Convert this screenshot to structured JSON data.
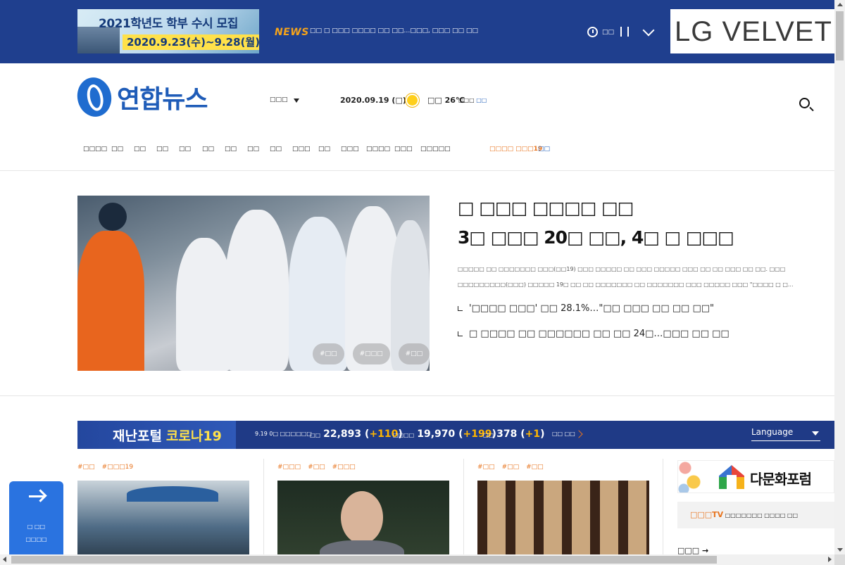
{
  "top_banner": {
    "ad_left": {
      "line1": "2021학년도 학부 수시 모집",
      "line2": "2020.9.23(수)~9.28(월)"
    },
    "news_label": "NEWS",
    "news_headline": "□□ □ □□□ □□□□ □□ □□…□□□, □□□ □□ □□",
    "clock_label": "□□",
    "ad_right": "LG VELVET"
  },
  "header": {
    "logo_text": "연합뉴스",
    "lang_label": "□□□",
    "date": "2020.09.19 (□)",
    "temperature": "□□ 26℃",
    "air_label": "□□□",
    "air_value": "□□"
  },
  "nav": {
    "items": [
      "□□□□",
      "□□",
      "□□",
      "□□",
      "□□",
      "□□",
      "□□",
      "□□",
      "□□",
      "□□□",
      "□□",
      "□□□",
      "□□□□",
      "□□□",
      "□□□□□"
    ],
    "special": "□□□□ □□□19",
    "extra": "□□"
  },
  "hero": {
    "title_line1": "□ □□□ □□□□ □□",
    "title_line2": "3□ □□□ 20□ □□, 4□ □ □□□",
    "summary": "□□□□□ □□ □□□□□□□ □□□(□□19) □□□ □□□□□ □□ □□□ □□□□□ □□□ □□ □□ □□□ □□ □□. □□□ □□□□□□□□□(□□□) □□□□□ 19□ □□ □□ □□□□□□□ □□ □□□□□□□ □□□ □□□□□ □□□ \"□□□□ □ □...",
    "links": [
      "'□□□□ □□□' □□ 28.1%…\"□□ □□□ □□ □□ □□\"",
      "□ □□□□ □□ □□□□□□ □□ □□ 24□…□□□ □□ □□"
    ],
    "tags": [
      "#□□",
      "#□□□",
      "#□□"
    ]
  },
  "covid": {
    "brand_main": "재난포털",
    "brand_accent": "코로나19",
    "timestamp": "9.19 0□ □□□□□□",
    "stats": [
      {
        "label": "□□",
        "value": "22,893",
        "delta": "+110"
      },
      {
        "label": "□□□□",
        "value": "19,970",
        "delta": "+199"
      },
      {
        "label": "□□",
        "value": "378",
        "delta": "+1"
      }
    ],
    "more": "□□ □□",
    "language": "Language"
  },
  "columns": [
    {
      "tags": [
        "#□□",
        "#□□□19"
      ]
    },
    {
      "tags": [
        "#□□□",
        "#□□",
        "#□□□"
      ]
    },
    {
      "tags": [
        "#□□",
        "#□□",
        "#□□"
      ]
    }
  ],
  "sidebar": {
    "forum_ad": "다문화포럼",
    "tv_brand": "□□□TV",
    "tv_text": "□□□□□□□ □□□□ □□",
    "more_label": "□□□"
  },
  "float_button": {
    "line1": "□ □□",
    "line2": "□□□□"
  },
  "colors": {
    "brand_blue": "#1f3f8e",
    "accent_orange": "#e8741e",
    "delta_yellow": "#ffb600"
  }
}
